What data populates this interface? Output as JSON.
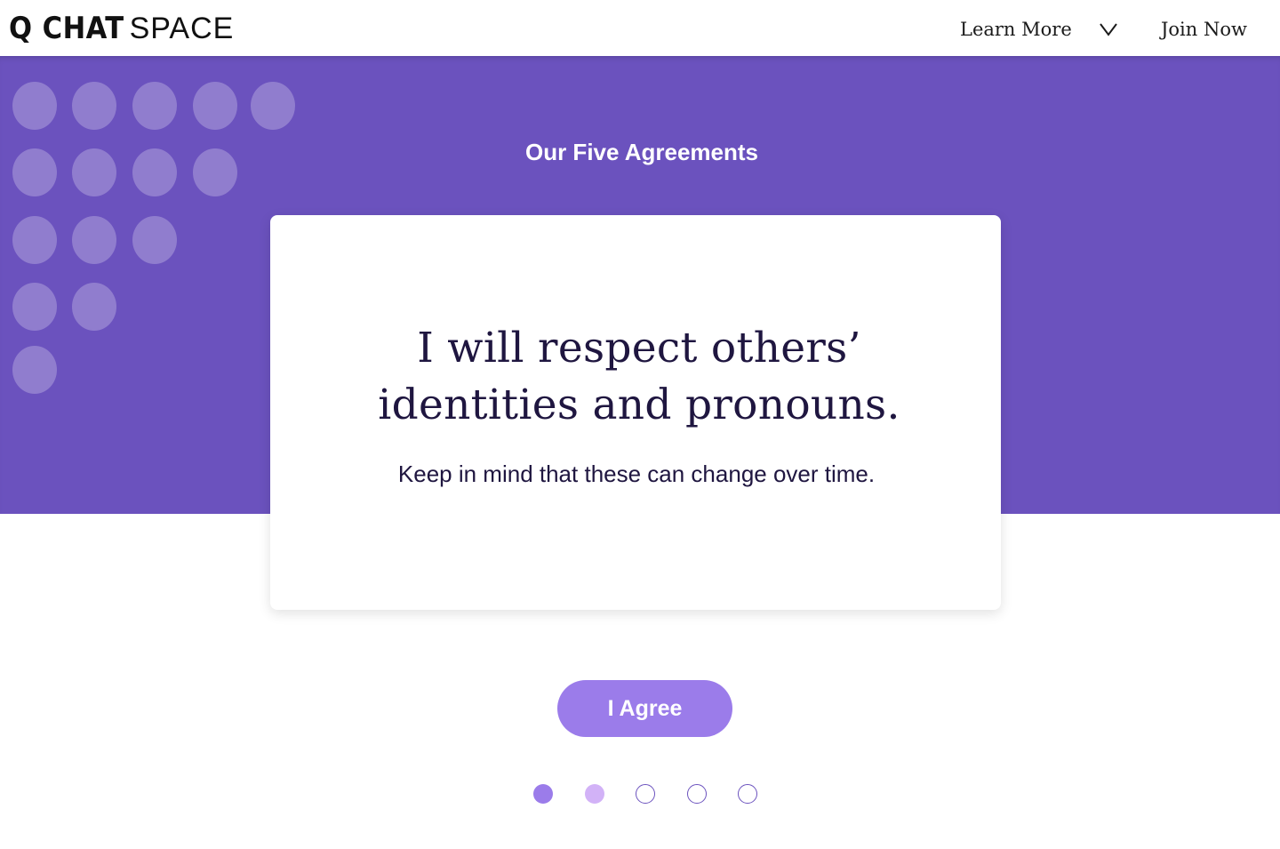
{
  "header": {
    "logo_bold": "Q CHAT",
    "logo_light": "SPACE",
    "nav": {
      "learn_more": "Learn More",
      "dropdown_icon": "chevron-down-icon",
      "join_now": "Join Now"
    }
  },
  "hero": {
    "section_title": "Our Five Agreements"
  },
  "card": {
    "title": "I will respect others’ identities and pronouns.",
    "subtitle": "Keep in mind that these can change over time."
  },
  "actions": {
    "agree_label": "I Agree"
  },
  "pagination": {
    "total": 5,
    "current": 1
  },
  "colors": {
    "hero_background": "#6b52be",
    "accent": "#9b7cea",
    "next_dot": "#d2b2f7",
    "heading_text": "#1f1640"
  }
}
